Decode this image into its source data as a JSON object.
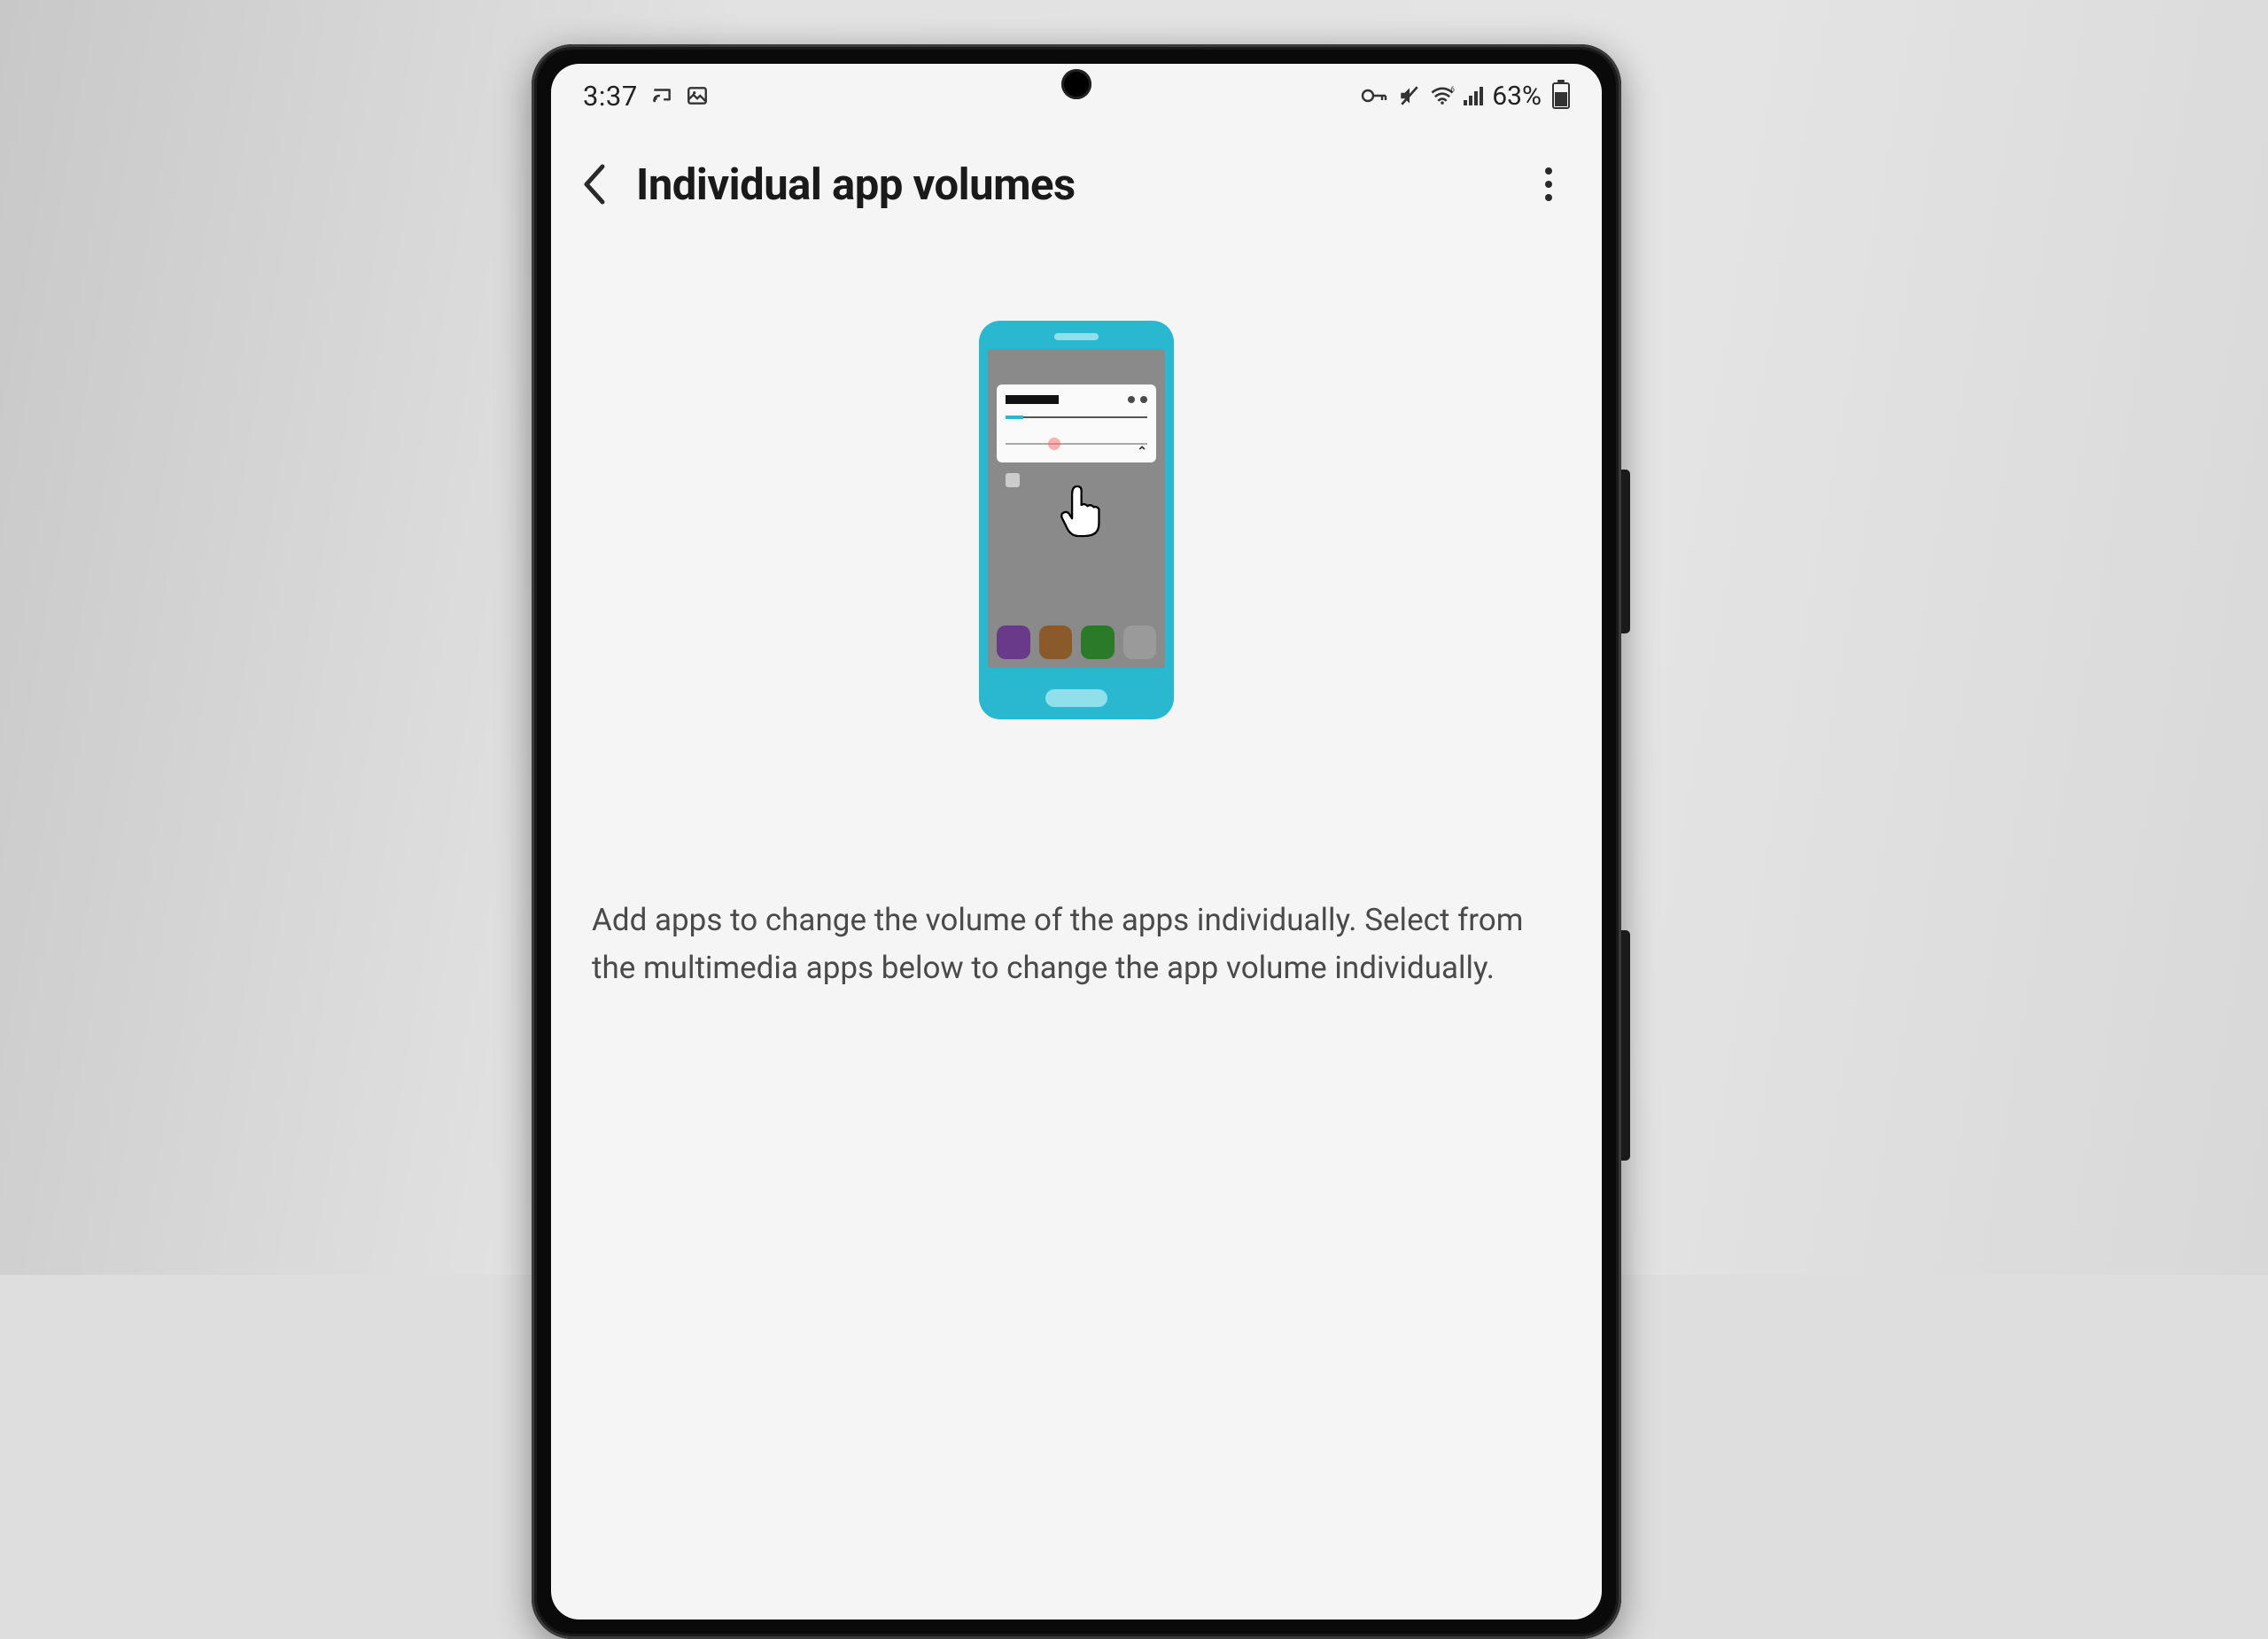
{
  "status_bar": {
    "time": "3:37",
    "battery_percent": "63%"
  },
  "header": {
    "title": "Individual app volumes"
  },
  "content": {
    "description": "Add apps to change the volume of the apps individually. Select from the multimedia apps below to change the app volume individually."
  },
  "illustration": {
    "app_colors": [
      "#6a3a8a",
      "#8a5a2a",
      "#2a7a2a",
      "#9a9a9a"
    ]
  }
}
